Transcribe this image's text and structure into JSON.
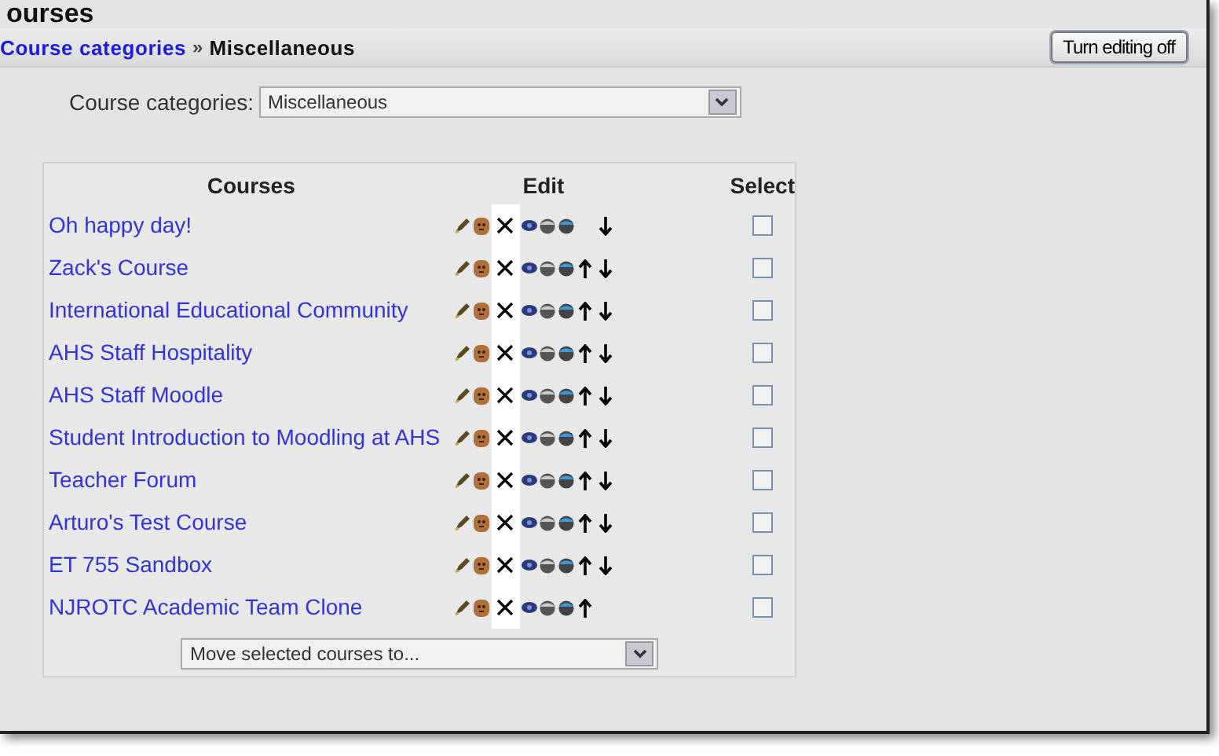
{
  "page_heading": "ourses",
  "breadcrumb": {
    "link": "Course categories",
    "separator": "»",
    "current": "Miscellaneous"
  },
  "editing_button": "Turn editing off",
  "category_select": {
    "label": "Course categories:",
    "value": "Miscellaneous"
  },
  "table": {
    "columns": [
      "Courses",
      "Edit",
      "Select"
    ],
    "rows": [
      {
        "name": "Oh happy day!",
        "can_move_up": false,
        "can_move_down": true,
        "checked": false
      },
      {
        "name": "Zack's Course",
        "can_move_up": true,
        "can_move_down": true,
        "checked": false
      },
      {
        "name": "International Educational Community",
        "can_move_up": true,
        "can_move_down": true,
        "checked": false
      },
      {
        "name": "AHS Staff Hospitality",
        "can_move_up": true,
        "can_move_down": true,
        "checked": false
      },
      {
        "name": "AHS Staff Moodle",
        "can_move_up": true,
        "can_move_down": true,
        "checked": false
      },
      {
        "name": "Student Introduction to Moodling at AHS",
        "can_move_up": true,
        "can_move_down": true,
        "checked": false
      },
      {
        "name": "Teacher Forum",
        "can_move_up": true,
        "can_move_down": true,
        "checked": false
      },
      {
        "name": "Arturo's Test Course",
        "can_move_up": true,
        "can_move_down": true,
        "checked": false
      },
      {
        "name": "ET 755 Sandbox",
        "can_move_up": true,
        "can_move_down": true,
        "checked": false
      },
      {
        "name": "NJROTC Academic Team Clone",
        "can_move_up": true,
        "can_move_down": false,
        "checked": false
      }
    ]
  },
  "move_select": {
    "value": "Move selected courses to..."
  }
}
